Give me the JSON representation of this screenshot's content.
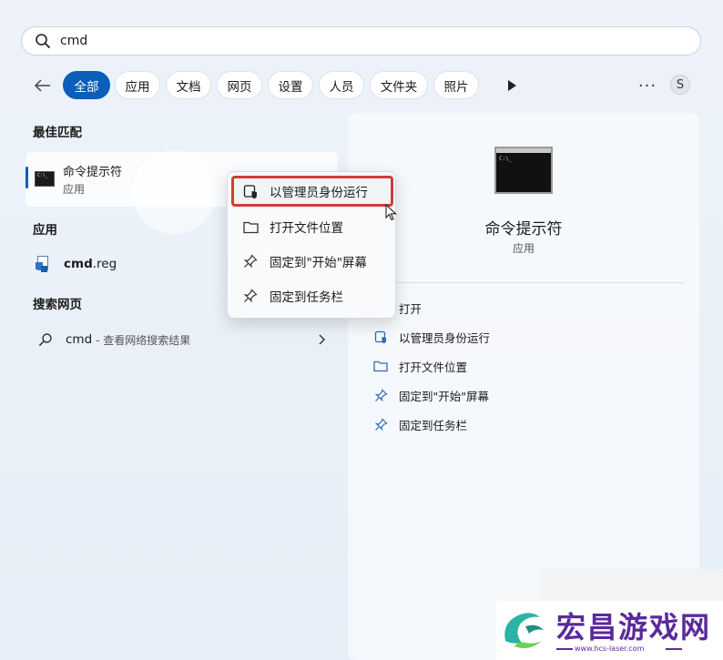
{
  "search": {
    "query": "cmd"
  },
  "filters": {
    "items": [
      {
        "label": "全部",
        "active": true
      },
      {
        "label": "应用"
      },
      {
        "label": "文档"
      },
      {
        "label": "网页"
      },
      {
        "label": "设置"
      },
      {
        "label": "人员"
      },
      {
        "label": "文件夹"
      },
      {
        "label": "照片"
      }
    ],
    "more": "···",
    "avatar": "S"
  },
  "best_match": {
    "title": "最佳匹配",
    "name": "命令提示符",
    "type": "应用"
  },
  "apps": {
    "title": "应用",
    "item_bold": "cmd",
    "item_rest": ".reg"
  },
  "web": {
    "title": "搜索网页",
    "term": "cmd",
    "hint": "- 查看网络搜索结果"
  },
  "context_menu": {
    "run_admin": "以管理员身份运行",
    "open_location": "打开文件位置",
    "pin_start": "固定到\"开始\"屏幕",
    "pin_taskbar": "固定到任务栏"
  },
  "detail": {
    "title": "命令提示符",
    "type": "应用",
    "actions": {
      "open": "打开",
      "run_admin": "以管理员身份运行",
      "open_location": "打开文件位置",
      "pin_start": "固定到\"开始\"屏幕",
      "pin_taskbar": "固定到任务栏"
    }
  },
  "watermark": {
    "brand": "宏昌游戏网",
    "url": "www.hcs-laser.com"
  },
  "colors": {
    "accent": "#0b5fb8",
    "highlight_border": "#d23b3b",
    "watermark": "#5a2a9c"
  }
}
